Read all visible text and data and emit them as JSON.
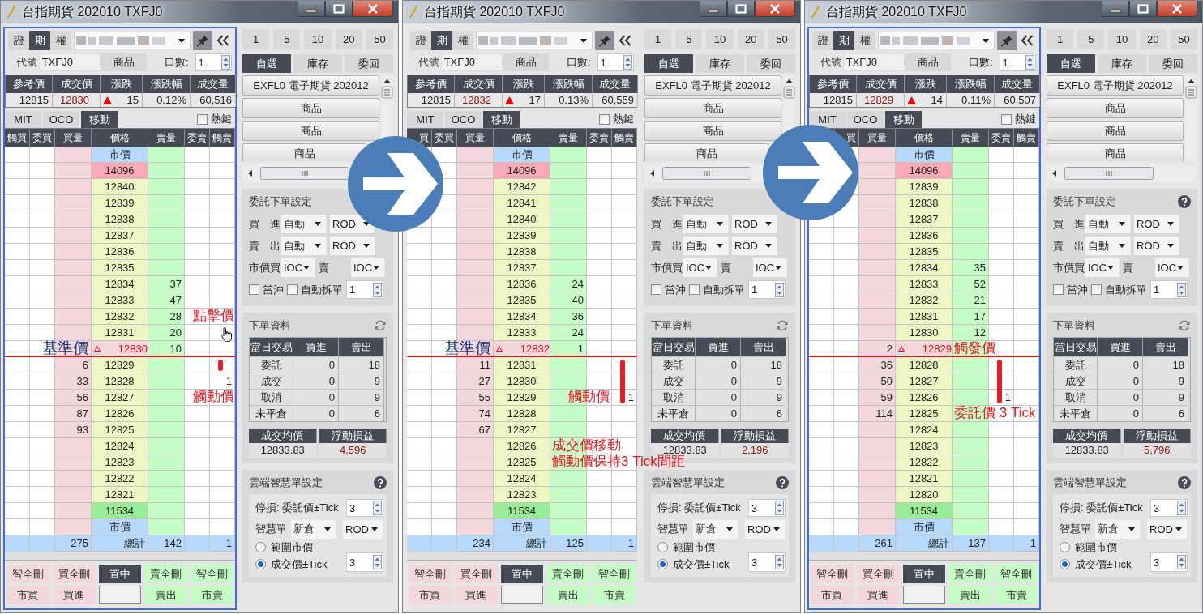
{
  "panels": [
    {
      "title": "台指期貨 202010 TXFJ0",
      "focused": true,
      "next_arrow": true,
      "market_tabs": [
        {
          "label": "證",
          "selected": false
        },
        {
          "label": "期",
          "selected": true
        },
        {
          "label": "權",
          "selected": false
        }
      ],
      "code": {
        "label": "代號",
        "value": "TXFJ0",
        "button": "商品",
        "qty_label": "口數:",
        "qty_value": "1"
      },
      "quote": {
        "columns": [
          "參考價",
          "成交價",
          "漲跌",
          "漲跌幅",
          "成交量"
        ],
        "values": [
          "12815",
          "12830",
          "15",
          "0.12%",
          "60,516"
        ],
        "up": true
      },
      "mode_tabs": [
        {
          "label": "MIT",
          "selected": false
        },
        {
          "label": "OCO",
          "selected": false
        },
        {
          "label": "移動",
          "selected": true
        }
      ],
      "hotkey": {
        "label": "熱鍵",
        "checked": false
      },
      "ladder": {
        "columns": {
          "trigger_buy": "觸買",
          "order_buy": "委買",
          "buy_qty": "買量",
          "price": "價格",
          "sell_qty": "賣量",
          "order_sell": "委賣",
          "trigger_sell": "觸賣"
        },
        "rows": [
          {
            "kind": "market",
            "price": "市價"
          },
          {
            "kind": "limit_up",
            "price": "14096"
          },
          {
            "kind": "normal",
            "price": "12840"
          },
          {
            "kind": "normal",
            "price": "12839"
          },
          {
            "kind": "normal",
            "price": "12838"
          },
          {
            "kind": "normal",
            "price": "12837"
          },
          {
            "kind": "normal",
            "price": "12836"
          },
          {
            "kind": "normal",
            "price": "12835"
          },
          {
            "kind": "normal",
            "price": "12834",
            "sell_qty": "37"
          },
          {
            "kind": "normal",
            "price": "12833",
            "sell_qty": "47"
          },
          {
            "kind": "normal",
            "price": "12832",
            "sell_qty": "28",
            "edge_note": "點擊價"
          },
          {
            "kind": "normal",
            "price": "12831",
            "sell_qty": "20",
            "cursor": true
          },
          {
            "kind": "reference",
            "price": "12830",
            "sell_qty": "10",
            "buy_note": "基準價"
          },
          {
            "kind": "normal",
            "price": "12829",
            "buy_qty": "6",
            "bar": true
          },
          {
            "kind": "normal",
            "price": "12828",
            "buy_qty": "33",
            "trigger_sell": "1"
          },
          {
            "kind": "normal",
            "price": "12827",
            "buy_qty": "56",
            "edge_note": "觸動價"
          },
          {
            "kind": "normal",
            "price": "12826",
            "buy_qty": "87"
          },
          {
            "kind": "normal",
            "price": "12825",
            "buy_qty": "93"
          },
          {
            "kind": "normal",
            "price": "12824"
          },
          {
            "kind": "normal",
            "price": "12823"
          },
          {
            "kind": "normal",
            "price": "12822"
          },
          {
            "kind": "normal",
            "price": "12821"
          },
          {
            "kind": "limit_down",
            "price": "11534"
          },
          {
            "kind": "market",
            "price": "市價"
          }
        ],
        "total": {
          "buy_qty": "275",
          "price": "總計",
          "sell_qty": "142",
          "trigger_sell": "1"
        }
      },
      "bottom_buttons": [
        [
          {
            "kind": "buy",
            "label": "智全刪"
          },
          {
            "kind": "buy",
            "label": "買全刪"
          },
          {
            "kind": "center",
            "label": "置中"
          },
          {
            "kind": "sell",
            "label": "賣全刪"
          },
          {
            "kind": "sell",
            "label": "智全刪"
          }
        ],
        [
          {
            "kind": "buy",
            "label": "市買"
          },
          {
            "kind": "buy",
            "label": "買進"
          },
          {
            "kind": "field"
          },
          {
            "kind": "sell",
            "label": "賣出"
          },
          {
            "kind": "sell",
            "label": "市賣"
          }
        ]
      ],
      "ticks": [
        "1",
        "5",
        "10",
        "20",
        "50"
      ],
      "list_tabs": [
        {
          "label": "自選",
          "selected": true
        },
        {
          "label": "庫存",
          "selected": false
        },
        {
          "label": "委回",
          "selected": false
        }
      ],
      "watchlist": [
        "EXFL0 電子期貨 202012",
        "商品",
        "商品",
        "商品"
      ],
      "order_settings": {
        "title": "委託下單設定",
        "help": false,
        "rows": [
          [
            {
              "kind": "label",
              "text": "買　進"
            },
            {
              "kind": "select",
              "text": "自動"
            },
            {
              "kind": "select",
              "text": "ROD"
            }
          ],
          [
            {
              "kind": "label",
              "text": "賣　出"
            },
            {
              "kind": "select",
              "text": "自動"
            },
            {
              "kind": "select",
              "text": "ROD"
            }
          ],
          [
            {
              "kind": "label",
              "text": "市價買"
            },
            {
              "kind": "select",
              "text": "IOC"
            },
            {
              "kind": "label",
              "text": "賣"
            },
            {
              "kind": "select",
              "text": "IOC"
            }
          ]
        ],
        "day_trade": {
          "label": "當沖",
          "checked": false
        },
        "auto_split": {
          "label": "自動拆單",
          "checked": false
        },
        "split_qty": "1"
      },
      "order_info": {
        "title": "下單資料",
        "columns": [
          "當日交易",
          "買進",
          "賣出"
        ],
        "rows": [
          [
            "委託",
            "0",
            "18"
          ],
          [
            "成交",
            "0",
            "9"
          ],
          [
            "取消",
            "0",
            "9"
          ],
          [
            "未平倉",
            "0",
            "6"
          ]
        ],
        "summary_columns": [
          "成交均價",
          "浮動損益"
        ],
        "summary_values": [
          "12833.83",
          "4,596"
        ]
      },
      "cloud": {
        "title": "雲端智慧單設定",
        "help": true,
        "stop_label": "停損: 委託價±Tick",
        "stop_value": "3",
        "smart_label": "智慧單",
        "smart_selects": [
          "新倉",
          "ROD"
        ],
        "radios": [
          {
            "label": "範圍市價",
            "selected": false
          },
          {
            "label": "成交價±Tick",
            "selected": true
          }
        ],
        "tick_value": "3"
      }
    },
    {
      "title": "台指期貨 202010 TXFJ0",
      "focused": false,
      "next_arrow": true,
      "market_tabs": [
        {
          "label": "證",
          "selected": false
        },
        {
          "label": "期",
          "selected": true
        },
        {
          "label": "權",
          "selected": false
        }
      ],
      "code": {
        "label": "代號",
        "value": "TXFJ0",
        "button": "商品",
        "qty_label": "口數:",
        "qty_value": "1"
      },
      "quote": {
        "columns": [
          "參考價",
          "成交價",
          "漲跌",
          "漲跌幅",
          "成交量"
        ],
        "values": [
          "12815",
          "12832",
          "17",
          "0.13%",
          "60,559"
        ],
        "up": true
      },
      "mode_tabs": [
        {
          "label": "MIT",
          "selected": false
        },
        {
          "label": "OCO",
          "selected": false
        },
        {
          "label": "移動",
          "selected": true
        }
      ],
      "hotkey": {
        "label": "熱鍵",
        "checked": false
      },
      "ladder": {
        "columns": {
          "trigger_buy": "買",
          "order_buy": "委買",
          "buy_qty": "買量",
          "price": "價格",
          "sell_qty": "賣量",
          "order_sell": "委賣",
          "trigger_sell": "觸賣"
        },
        "rows": [
          {
            "kind": "market",
            "price": "市價"
          },
          {
            "kind": "limit_up",
            "price": "14096"
          },
          {
            "kind": "normal",
            "price": "12842"
          },
          {
            "kind": "normal",
            "price": "12841"
          },
          {
            "kind": "normal",
            "price": "12840"
          },
          {
            "kind": "normal",
            "price": "12839"
          },
          {
            "kind": "normal",
            "price": "12838"
          },
          {
            "kind": "normal",
            "price": "12837"
          },
          {
            "kind": "normal",
            "price": "12836",
            "sell_qty": "24"
          },
          {
            "kind": "normal",
            "price": "12835",
            "sell_qty": "40"
          },
          {
            "kind": "normal",
            "price": "12834",
            "sell_qty": "36"
          },
          {
            "kind": "normal",
            "price": "12833",
            "sell_qty": "24"
          },
          {
            "kind": "reference",
            "price": "12832",
            "sell_qty": "1",
            "buy_note": "基準價"
          },
          {
            "kind": "normal",
            "price": "12831",
            "buy_qty": "11",
            "bar": true
          },
          {
            "kind": "normal",
            "price": "12830",
            "buy_qty": "27",
            "bar": true
          },
          {
            "kind": "normal",
            "price": "12829",
            "buy_qty": "55",
            "bar": true,
            "trigger_sell": "1",
            "trigger_note": "觸動價"
          },
          {
            "kind": "normal",
            "price": "12828",
            "buy_qty": "74"
          },
          {
            "kind": "normal",
            "price": "12827",
            "buy_qty": "67"
          },
          {
            "kind": "normal",
            "price": "12826",
            "sell_note": "成交價移動"
          },
          {
            "kind": "normal",
            "price": "12825",
            "sell_note": "觸動價保持3 Tick間距"
          },
          {
            "kind": "normal",
            "price": "12824"
          },
          {
            "kind": "normal",
            "price": "12823"
          },
          {
            "kind": "limit_down",
            "price": "11534"
          },
          {
            "kind": "market",
            "price": "市價"
          }
        ],
        "total": {
          "buy_qty": "234",
          "price": "總計",
          "sell_qty": "125",
          "trigger_sell": "1"
        }
      },
      "bottom_buttons": [
        [
          {
            "kind": "buy",
            "label": "智全刪"
          },
          {
            "kind": "buy",
            "label": "買全刪"
          },
          {
            "kind": "center",
            "label": "置中"
          },
          {
            "kind": "sell",
            "label": "賣全刪"
          },
          {
            "kind": "sell",
            "label": "智全刪"
          }
        ],
        [
          {
            "kind": "buy",
            "label": "市買"
          },
          {
            "kind": "buy",
            "label": "買進"
          },
          {
            "kind": "field"
          },
          {
            "kind": "sell",
            "label": "賣出"
          },
          {
            "kind": "sell",
            "label": "市賣"
          }
        ]
      ],
      "ticks": [
        "1",
        "5",
        "10",
        "20",
        "50"
      ],
      "list_tabs": [
        {
          "label": "自選",
          "selected": true
        },
        {
          "label": "庫存",
          "selected": false
        },
        {
          "label": "委回",
          "selected": false
        }
      ],
      "watchlist": [
        "EXFL0 電子期貨 202012",
        "商品",
        "商品",
        "商品"
      ],
      "order_settings": {
        "title": "委託下單設定",
        "help": false,
        "rows": [
          [
            {
              "kind": "label",
              "text": "買　進"
            },
            {
              "kind": "select",
              "text": "自動"
            },
            {
              "kind": "select",
              "text": "ROD"
            }
          ],
          [
            {
              "kind": "label",
              "text": "賣　出"
            },
            {
              "kind": "select",
              "text": "自動"
            },
            {
              "kind": "select",
              "text": "ROD"
            }
          ],
          [
            {
              "kind": "label",
              "text": "市價買"
            },
            {
              "kind": "select",
              "text": "IOC"
            },
            {
              "kind": "label",
              "text": "賣"
            },
            {
              "kind": "select",
              "text": "IOC"
            }
          ]
        ],
        "day_trade": {
          "label": "當沖",
          "checked": false
        },
        "auto_split": {
          "label": "自動拆單",
          "checked": false
        },
        "split_qty": "1"
      },
      "order_info": {
        "title": "下單資料",
        "columns": [
          "當日交易",
          "買進",
          "賣出"
        ],
        "rows": [
          [
            "委託",
            "0",
            "18"
          ],
          [
            "成交",
            "0",
            "9"
          ],
          [
            "取消",
            "0",
            "9"
          ],
          [
            "未平倉",
            "0",
            "6"
          ]
        ],
        "summary_columns": [
          "成交均價",
          "浮動損益"
        ],
        "summary_values": [
          "12833.83",
          "2,196"
        ]
      },
      "cloud": {
        "title": "雲端智慧單設定",
        "help": true,
        "stop_label": "停損: 委託價±Tick",
        "stop_value": "3",
        "smart_label": "智慧單",
        "smart_selects": [
          "新倉",
          "ROD"
        ],
        "radios": [
          {
            "label": "範圍市價",
            "selected": false
          },
          {
            "label": "成交價±Tick",
            "selected": true
          }
        ],
        "tick_value": "3"
      }
    },
    {
      "title": "台指期貨 202010 TXFJ0",
      "focused": true,
      "next_arrow": false,
      "market_tabs": [
        {
          "label": "證",
          "selected": false
        },
        {
          "label": "期",
          "selected": true
        },
        {
          "label": "權",
          "selected": false
        }
      ],
      "code": {
        "label": "代號",
        "value": "TXFJ0",
        "button": "商品",
        "qty_label": "口數:",
        "qty_value": "1"
      },
      "quote": {
        "columns": [
          "參考價",
          "成交價",
          "漲跌",
          "漲跌幅",
          "成交量"
        ],
        "values": [
          "12815",
          "12829",
          "14",
          "0.11%",
          "60,507"
        ],
        "up": true
      },
      "mode_tabs": [
        {
          "label": "MIT",
          "selected": false
        },
        {
          "label": "OCO",
          "selected": false
        },
        {
          "label": "移動",
          "selected": true
        }
      ],
      "hotkey": {
        "label": "熱鍵",
        "checked": false
      },
      "ladder": {
        "columns": {
          "order_buy": "買",
          "buy_qty": "買量",
          "price": "價格",
          "sell_qty": "賣量",
          "order_sell": "委賣",
          "trigger_sell": "觸賣"
        },
        "rows": [
          {
            "kind": "market",
            "price": "市價"
          },
          {
            "kind": "limit_up",
            "price": "14096"
          },
          {
            "kind": "normal",
            "price": "12839"
          },
          {
            "kind": "normal",
            "price": "12838"
          },
          {
            "kind": "normal",
            "price": "12837"
          },
          {
            "kind": "normal",
            "price": "12836"
          },
          {
            "kind": "normal",
            "price": "12835"
          },
          {
            "kind": "normal",
            "price": "12834",
            "sell_qty": "35"
          },
          {
            "kind": "normal",
            "price": "12833",
            "sell_qty": "52"
          },
          {
            "kind": "normal",
            "price": "12832",
            "sell_qty": "21"
          },
          {
            "kind": "normal",
            "price": "12831",
            "sell_qty": "17"
          },
          {
            "kind": "normal",
            "price": "12830",
            "sell_qty": "12"
          },
          {
            "kind": "reference",
            "price": "12829",
            "buy_qty": "2",
            "sell_note": "觸發價"
          },
          {
            "kind": "normal",
            "price": "12828",
            "buy_qty": "36",
            "bar": true
          },
          {
            "kind": "normal",
            "price": "12827",
            "buy_qty": "50",
            "bar": true
          },
          {
            "kind": "normal",
            "price": "12826",
            "buy_qty": "59",
            "bar": true,
            "order_sell": "1"
          },
          {
            "kind": "normal",
            "price": "12825",
            "buy_qty": "114",
            "sell_note": "委託價 3 Tick"
          },
          {
            "kind": "normal",
            "price": "12824"
          },
          {
            "kind": "normal",
            "price": "12823"
          },
          {
            "kind": "normal",
            "price": "12822"
          },
          {
            "kind": "normal",
            "price": "12821"
          },
          {
            "kind": "normal",
            "price": "12820"
          },
          {
            "kind": "limit_down",
            "price": "11534"
          },
          {
            "kind": "market",
            "price": "市價"
          }
        ],
        "total": {
          "buy_qty": "261",
          "price": "總計",
          "sell_qty": "137",
          "trigger_sell": "1"
        }
      },
      "bottom_buttons": [
        [
          {
            "kind": "buy",
            "label": "智全刪"
          },
          {
            "kind": "buy",
            "label": "買全刪"
          },
          {
            "kind": "center",
            "label": "置中"
          },
          {
            "kind": "sell",
            "label": "賣全刪"
          },
          {
            "kind": "sell",
            "label": "智全刪"
          }
        ],
        [
          {
            "kind": "buy",
            "label": "市買"
          },
          {
            "kind": "buy",
            "label": "買進"
          },
          {
            "kind": "field"
          },
          {
            "kind": "sell",
            "label": "賣出"
          },
          {
            "kind": "sell",
            "label": "市賣"
          }
        ]
      ],
      "ticks": [
        "1",
        "5",
        "10",
        "20",
        "50"
      ],
      "list_tabs": [
        {
          "label": "自選",
          "selected": true
        },
        {
          "label": "庫存",
          "selected": false
        },
        {
          "label": "委回",
          "selected": false
        }
      ],
      "watchlist": [
        "EXFL0 電子期貨 202012",
        "商品",
        "商品",
        "商品"
      ],
      "order_settings": {
        "title": "委託下單設定",
        "help": true,
        "rows": [
          [
            {
              "kind": "label",
              "text": "買　進"
            },
            {
              "kind": "select",
              "text": "自動"
            },
            {
              "kind": "select",
              "text": "ROD"
            }
          ],
          [
            {
              "kind": "label",
              "text": "賣　出"
            },
            {
              "kind": "select",
              "text": "自動"
            },
            {
              "kind": "select",
              "text": "ROD"
            }
          ],
          [
            {
              "kind": "label",
              "text": "市價買"
            },
            {
              "kind": "select",
              "text": "IOC"
            },
            {
              "kind": "label",
              "text": "賣"
            },
            {
              "kind": "select",
              "text": "IOC"
            }
          ]
        ],
        "day_trade": {
          "label": "當沖",
          "checked": false
        },
        "auto_split": {
          "label": "自動拆單",
          "checked": false
        },
        "split_qty": "1"
      },
      "order_info": {
        "title": "下單資料",
        "columns": [
          "當日交易",
          "買進",
          "賣出"
        ],
        "rows": [
          [
            "委託",
            "0",
            "18"
          ],
          [
            "成交",
            "0",
            "9"
          ],
          [
            "取消",
            "0",
            "9"
          ],
          [
            "未平倉",
            "0",
            "6"
          ]
        ],
        "summary_columns": [
          "成交均價",
          "浮動損益"
        ],
        "summary_values": [
          "12833.83",
          "5,796"
        ]
      },
      "cloud": {
        "title": "雲端智慧單設定",
        "help": true,
        "stop_label": "停損: 委託價±Tick",
        "stop_value": "3",
        "smart_label": "智慧單",
        "smart_selects": [
          "新倉",
          "ROD"
        ],
        "radios": [
          {
            "label": "範圍市價",
            "selected": false
          },
          {
            "label": "成交價±Tick",
            "selected": true
          }
        ],
        "tick_value": "3"
      }
    }
  ]
}
